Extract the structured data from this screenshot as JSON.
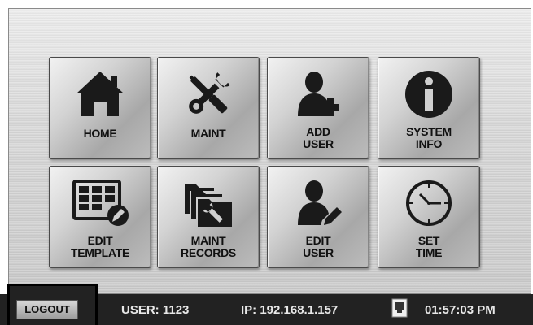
{
  "tiles": [
    {
      "line1": "HOME",
      "line2": "",
      "icon": "home-icon"
    },
    {
      "line1": "MAINT",
      "line2": "",
      "icon": "tools-icon"
    },
    {
      "line1": "ADD",
      "line2": "USER",
      "icon": "add-user-icon"
    },
    {
      "line1": "SYSTEM",
      "line2": "INFO",
      "icon": "info-icon"
    },
    {
      "line1": "EDIT",
      "line2": "TEMPLATE",
      "icon": "edit-template-icon"
    },
    {
      "line1": "MAINT",
      "line2": "RECORDS",
      "icon": "folder-wrench-icon"
    },
    {
      "line1": "EDIT",
      "line2": "USER",
      "icon": "edit-user-icon"
    },
    {
      "line1": "SET",
      "line2": "TIME",
      "icon": "clock-icon"
    }
  ],
  "status": {
    "logout_label": "LOGOUT",
    "user": "USER: 1123",
    "ip": "IP: 192.168.1.157",
    "network_icon": "network-port-icon",
    "time": "01:57:03 PM"
  },
  "colors": {
    "statusbar": "#222222",
    "tile_border": "#4a4a4a",
    "icon": "#1a1a1a"
  }
}
